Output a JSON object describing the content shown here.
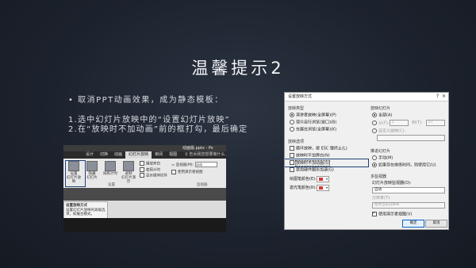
{
  "slide": {
    "title": "温馨提示2",
    "bullet": "•  取消PPT动画效果，成为静态模板：",
    "step1": "1.选中幻灯片放映中的“设置幻灯片放映”",
    "step2": "2.在“放映时不加动画”前的框打勾，最后确定"
  },
  "ribbon": {
    "file_title": "动画版.pptx - Po",
    "tabs": [
      "设计",
      "切换",
      "动画",
      "幻灯片放映",
      "审阅",
      "视图"
    ],
    "active_tab": "幻灯片放映",
    "search_hint": "♀ 告诉我您想要做什么...",
    "buttons": [
      {
        "label": "设置\n幻灯片放映"
      },
      {
        "label": "隐藏\n幻灯片"
      },
      {
        "label": "排练计时"
      },
      {
        "label": "录制\n幻灯片演示"
      }
    ],
    "checks": [
      "播放旁白",
      "使用计时",
      "显示媒体控件"
    ],
    "monitor_label": "监视器(M):",
    "monitor_value": "自动",
    "presenter_view": "使用演示者视图",
    "group_setup": "设置",
    "group_monitor": "监视器",
    "tooltip_title": "设置放映方式",
    "tooltip_body": "设置幻灯片放映的高级选项，如展台模式。"
  },
  "dialog": {
    "title": "设置放映方式",
    "help": "?",
    "close": "×",
    "show_type": {
      "header": "放映类型",
      "options": [
        "演讲者放映(全屏幕)(P)",
        "观众自行浏览(窗口)(B)",
        "在展台浏览(全屏幕)(K)"
      ]
    },
    "show_options": {
      "header": "放映选项",
      "options": [
        "循环放映，按 ESC 键终止(L)",
        "放映时不加旁白(N)",
        "放映时不加动画(S)",
        "禁用硬件图形加速(G)"
      ],
      "pen_color_label": "绘图笔颜色(E):",
      "laser_color_label": "激光笔颜色(R):"
    },
    "show_slides": {
      "header": "放映幻灯片",
      "all": "全部(A)",
      "from": "从(F):",
      "from_value": "1",
      "to": "到(T):",
      "to_value": "27",
      "custom": "自定义放映(C):"
    },
    "advance": {
      "header": "推进幻灯片",
      "manual": "手动(M)",
      "timing": "如果存在排练时间，则使用它(U)"
    },
    "monitors": {
      "header": "多监视器",
      "show_on_label": "幻灯片放映监视器(O):",
      "show_on_value": "自动",
      "resolution_label": "分辨率(T):",
      "resolution_value": "使用当前分辨率",
      "presenter_view": "使用演示者视图(V)"
    },
    "ok": "确定",
    "cancel": "取消"
  }
}
